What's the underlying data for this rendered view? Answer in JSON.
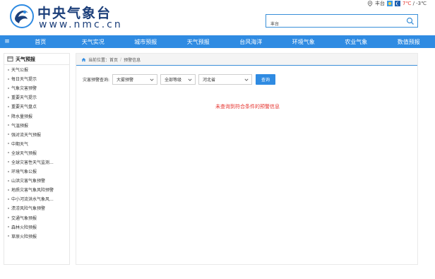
{
  "site": {
    "title": "中央气象台",
    "url": "www.nmc.cn"
  },
  "weather": {
    "city": "丰台",
    "temp_high": "7℃",
    "temp_sep": " / ",
    "temp_low": "-3℃"
  },
  "search": {
    "value": "丰台",
    "placeholder": ""
  },
  "nav": {
    "items": [
      "首页",
      "天气实况",
      "城市预报",
      "天气预报",
      "台风海洋",
      "环境气象",
      "农业气象",
      "数值预报"
    ]
  },
  "sidebar": {
    "title": "天气预报",
    "items": [
      "天气公报",
      "每日天气提示",
      "气象灾害预警",
      "重要天气提示",
      "重要天气盘点",
      "降水量预报",
      "气温预报",
      "强对流天气预报",
      "中期天气",
      "全球天气预报",
      "全球灾害性天气监测...",
      "环境气象公报",
      "山洪灾害气象预警",
      "地质灾害气象风险预警",
      "中小河流洪水气象风...",
      "渍涝风险气象预警",
      "交通气象预报",
      "森林火险预报",
      "草原火险预报"
    ]
  },
  "breadcrumb": {
    "prefix": "当前位置：",
    "home": "首页",
    "sep": "/",
    "current": "预警信息"
  },
  "filter": {
    "label": "灾害预警查询:",
    "type_select": "大雾预警",
    "level_select": "全部等级",
    "province_select": "河北省",
    "query_button": "查询"
  },
  "result": {
    "empty_message": "未查询到符合条件的预警信息"
  },
  "colors": {
    "brand_blue": "#2f8be2",
    "logo_navy": "#1c3f7a",
    "alert_red": "#e5322d"
  }
}
